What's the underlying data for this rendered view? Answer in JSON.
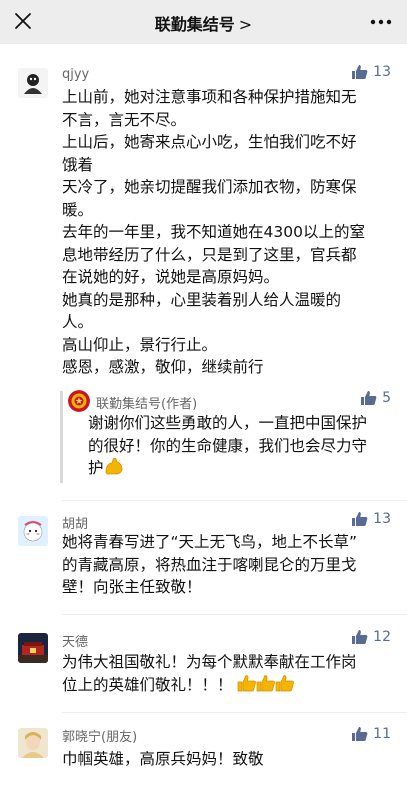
{
  "header": {
    "title": "联勤集结号",
    "chevron": ">",
    "close_icon": "close-icon",
    "more_icon": "more-icon"
  },
  "comments": [
    {
      "user": "qjyy",
      "likes": "13",
      "lines": [
        "上山前，她对注意事项和各种保护措施知无",
        "不言，言无不尽。",
        "上山后，她寄来点心小吃，生怕我们吃不好",
        "饿着",
        "天冷了，她亲切提醒我们添加衣物，防寒保",
        "暖。",
        "去年的一年里，我不知道她在4300以上的窒",
        "息地带经历了什么，只是到了这里，官兵都",
        "在说她的好，说她是高原妈妈。",
        "她真的是那种，心里装着别人给人温暖的",
        "人。",
        "高山仰止，景行行止。",
        "感恩，感激，敬仰，继续前行"
      ],
      "reply": {
        "user": "联勤集结号(作者)",
        "likes": "5",
        "lines": [
          "谢谢你们这些勇敢的人，一直把中国保护",
          "的很好！你的生命健康，我们也会尽力守",
          "护"
        ],
        "emoji": "flexed-biceps-emoji"
      }
    },
    {
      "user": "胡胡",
      "likes": "13",
      "lines": [
        "她将青春写进了“天上无飞鸟，地上不长草”",
        "的青藏高原，将热血注于喀喇昆仑的万里戈",
        "壁！向张主任致敬！"
      ]
    },
    {
      "user": "天德",
      "likes": "12",
      "lines": [
        "为伟大祖国敬礼！为每个默默奉献在工作岗",
        "位上的英雄们敬礼！！！"
      ],
      "emoji": "thumbs-up-emoji"
    },
    {
      "user": "郭晓宁(朋友)",
      "likes": "11",
      "lines": [
        "巾帼英雄，高原兵妈妈！致敬"
      ]
    }
  ],
  "colors": {
    "link_blue": "#576b95",
    "header_bg": "#ededed",
    "emoji_yellow": "#f5b400"
  }
}
